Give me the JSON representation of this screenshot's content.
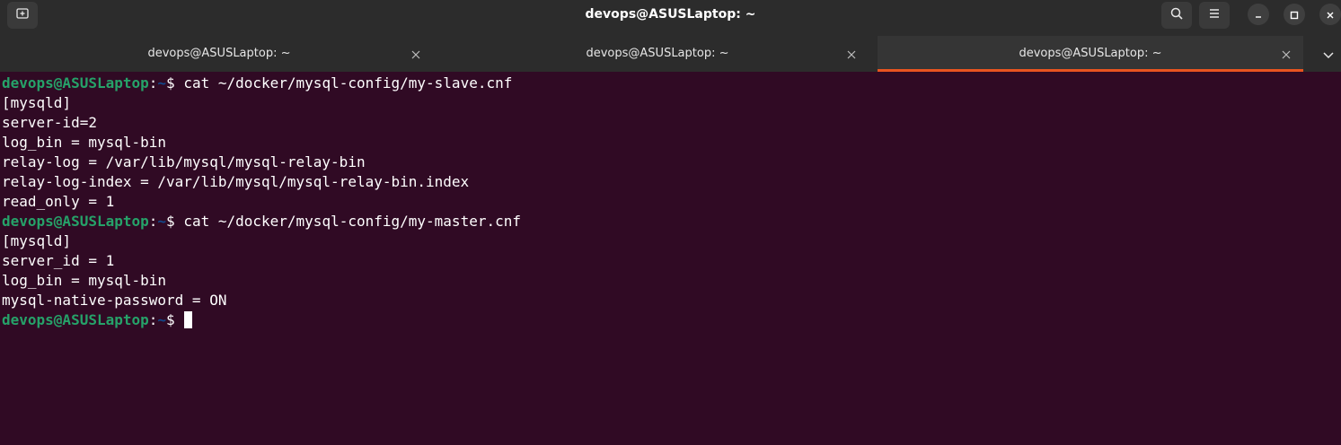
{
  "window": {
    "title": "devops@ASUSLaptop: ~"
  },
  "tabs": [
    {
      "label": "devops@ASUSLaptop: ~",
      "active": false
    },
    {
      "label": "devops@ASUSLaptop: ~",
      "active": false
    },
    {
      "label": "devops@ASUSLaptop: ~",
      "active": true
    }
  ],
  "colors": {
    "terminal_bg": "#300a24",
    "prompt_user": "#26a269",
    "prompt_path": "#12488b",
    "active_tab_accent": "#e95420"
  },
  "icons": {
    "new_tab": "new-tab-icon",
    "search": "search-icon",
    "menu": "hamburger-menu-icon",
    "minimize": "minimize-icon",
    "maximize": "maximize-icon",
    "close": "close-icon",
    "tab_close": "close-icon",
    "tab_list": "chevron-down-icon"
  },
  "terminal": {
    "prompt_user": "devops@ASUSLaptop",
    "prompt_sep": ":",
    "prompt_path": "~",
    "prompt_symbol": "$ ",
    "lines": [
      {
        "type": "command",
        "text": "cat ~/docker/mysql-config/my-slave.cnf"
      },
      {
        "type": "output",
        "text": "[mysqld]"
      },
      {
        "type": "output",
        "text": "server-id=2"
      },
      {
        "type": "output",
        "text": "log_bin = mysql-bin"
      },
      {
        "type": "output",
        "text": "relay-log = /var/lib/mysql/mysql-relay-bin"
      },
      {
        "type": "output",
        "text": "relay-log-index = /var/lib/mysql/mysql-relay-bin.index"
      },
      {
        "type": "output",
        "text": "read_only = 1"
      },
      {
        "type": "command",
        "text": "cat ~/docker/mysql-config/my-master.cnf"
      },
      {
        "type": "output",
        "text": "[mysqld]"
      },
      {
        "type": "output",
        "text": "server_id = 1"
      },
      {
        "type": "output",
        "text": "log_bin = mysql-bin"
      },
      {
        "type": "output",
        "text": "mysql-native-password = ON"
      },
      {
        "type": "command",
        "text": ""
      }
    ]
  }
}
